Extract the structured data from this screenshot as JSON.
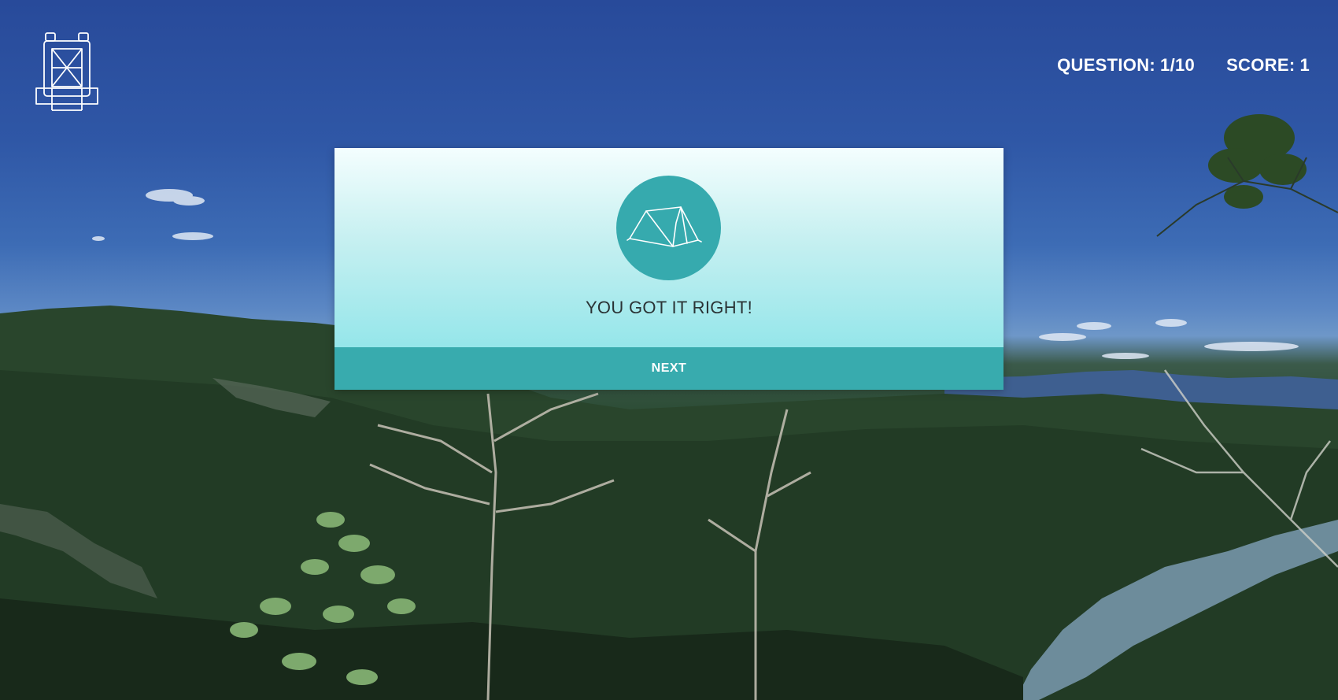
{
  "header": {
    "logo_icon": "backpack-icon",
    "question_label": "QUESTION:",
    "question_value": "1/10",
    "score_label": "SCORE:",
    "score_value": "1"
  },
  "modal": {
    "icon": "tent-icon",
    "message": "YOU GOT IT RIGHT!",
    "next_label": "NEXT"
  },
  "colors": {
    "accent": "#38abae",
    "modal_top": "#f4fefe",
    "modal_bottom": "#95e6ea",
    "text_dark": "#2a3335"
  }
}
